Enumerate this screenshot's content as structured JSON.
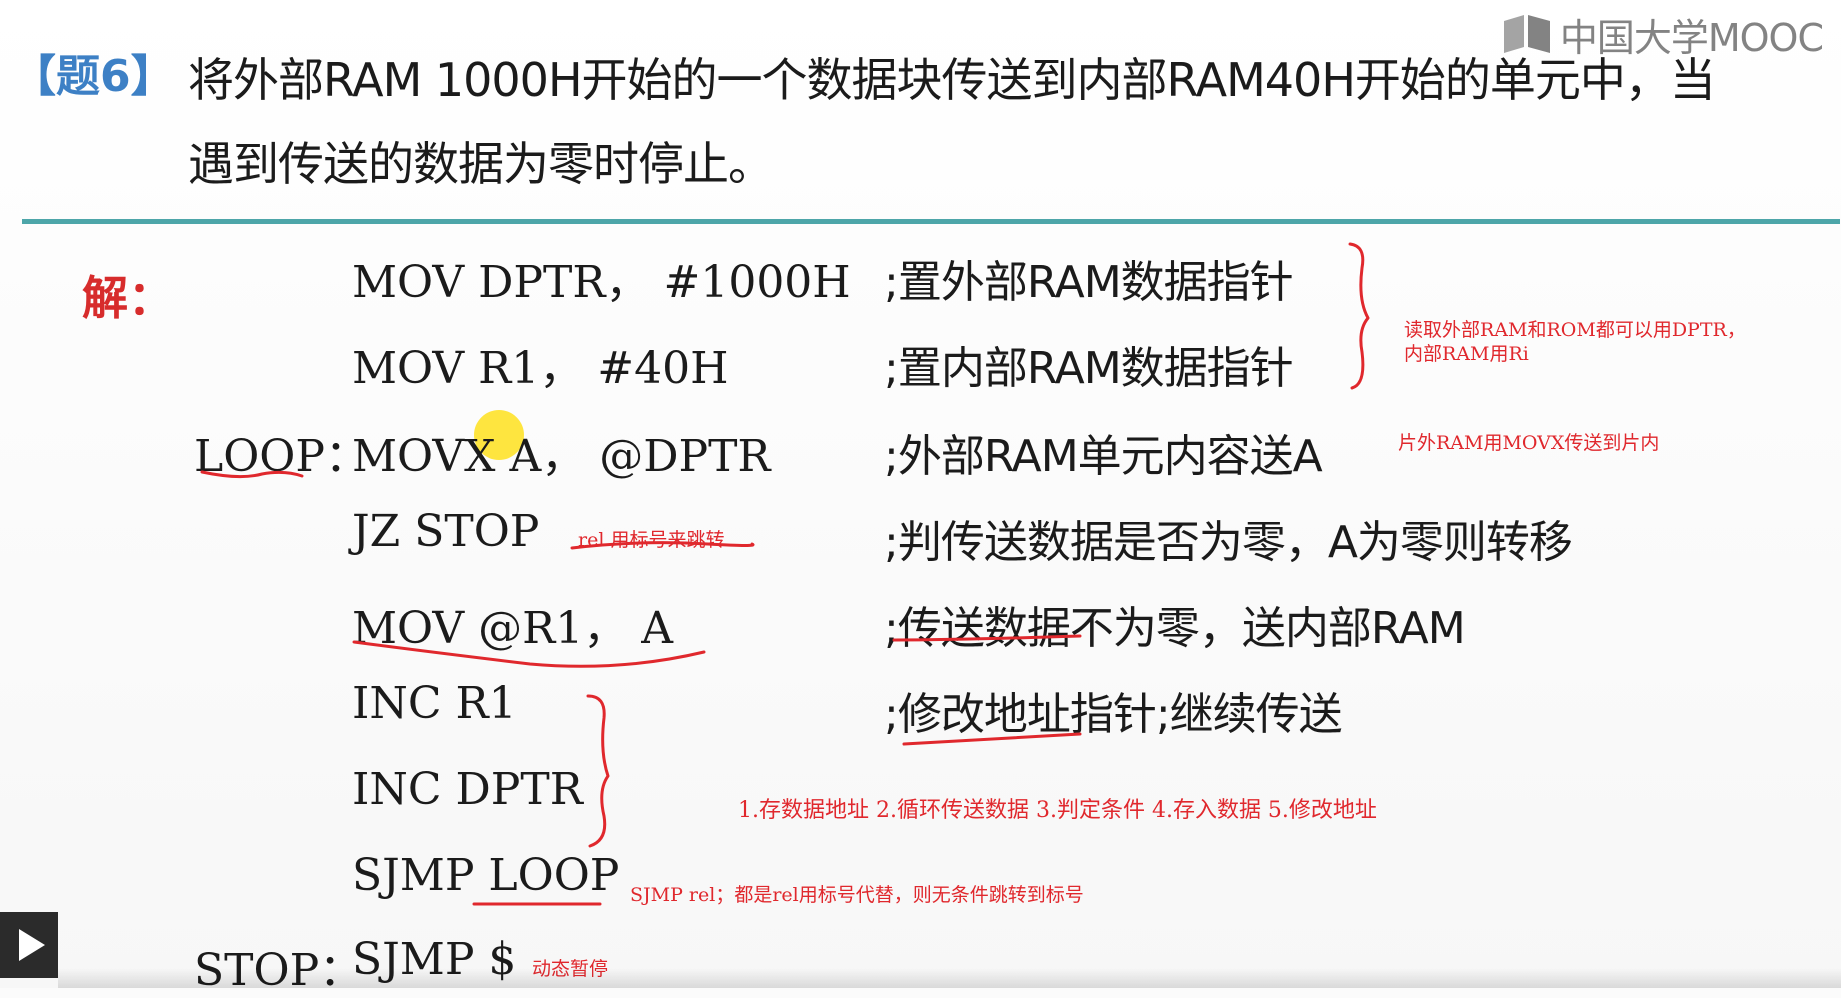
{
  "watermark": {
    "text": "中国大学MOOC",
    "icon": "mooc-book-icon"
  },
  "question": {
    "tag": "【题6】",
    "line1": "将外部RAM 1000H开始的一个数据块传送到内部RAM40H开始的单元中，当",
    "line2": "遇到传送的数据为零时停止。"
  },
  "answer_label": "解：",
  "code": [
    {
      "label": "",
      "instr": "MOV DPTR， #1000H",
      "comment": ";置外部RAM数据指针"
    },
    {
      "label": "",
      "instr": "MOV  R1， #40H",
      "comment": ";置内部RAM数据指针"
    },
    {
      "label": "LOOP：",
      "instr": "MOVX  A， @DPTR",
      "comment": ";外部RAM单元内容送A"
    },
    {
      "label": "",
      "instr": "JZ  STOP",
      "comment": ";判传送数据是否为零，A为零则转移"
    },
    {
      "label": "",
      "instr": "MOV  @R1， A",
      "comment": ";传送数据不为零，送内部RAM"
    },
    {
      "label": "",
      "instr": "INC R1",
      "comment": ";修改地址指针;继续传送"
    },
    {
      "label": "",
      "instr": "INC DPTR",
      "comment": ""
    },
    {
      "label": "",
      "instr": "SJMP LOOP",
      "comment": ""
    },
    {
      "label": "STOP：",
      "instr": "SJMP $",
      "comment": ""
    }
  ],
  "annotations": {
    "read_line1": "读取外部RAM和ROM都可以用DPTR，",
    "read_line2": "内部RAM用Ri",
    "movx": "片外RAM用MOVX传送到片内",
    "rel": "rel 用标号来跳转",
    "steps": "1.存数据地址 2.循环传送数据 3.判定条件 4.存入数据 5.修改地址",
    "sjmp": "SJMP rel；都是rel用标号代替，则无条件跳转到标号",
    "stop": "动态暂停"
  },
  "colors": {
    "question_tag": "#3d80c5",
    "answer_label": "#d72c2c",
    "divider": "#4da6a9",
    "annotation": "#e0282d",
    "cursor_highlight": "#ffde00"
  },
  "player": {
    "play_icon": "play-icon"
  }
}
